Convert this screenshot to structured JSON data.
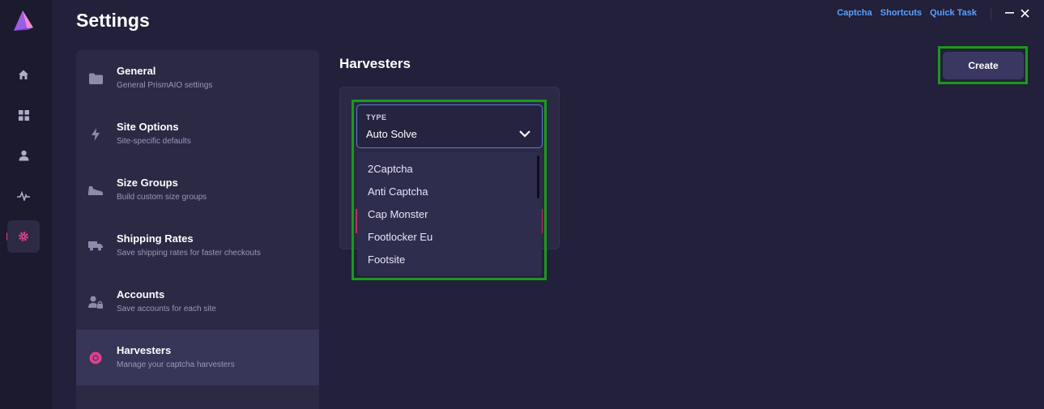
{
  "app": {
    "title": "Settings",
    "brand_color": "#a060e0",
    "accent": "#e0408a"
  },
  "rail": {
    "items": [
      {
        "name": "home",
        "icon": "home-icon"
      },
      {
        "name": "dashboard",
        "icon": "grid-icon"
      },
      {
        "name": "profiles",
        "icon": "user-icon"
      },
      {
        "name": "activity",
        "icon": "activity-icon"
      },
      {
        "name": "settings",
        "icon": "gear-icon",
        "active": true
      }
    ]
  },
  "top_links": {
    "captcha": "Captcha",
    "shortcuts": "Shortcuts",
    "quick_task": "Quick Task"
  },
  "menu": {
    "items": [
      {
        "title": "General",
        "desc": "General PrismAIO settings",
        "icon": "folder-icon"
      },
      {
        "title": "Site Options",
        "desc": "Site-specific defaults",
        "icon": "bolt-icon"
      },
      {
        "title": "Size Groups",
        "desc": "Build custom size groups",
        "icon": "shoe-icon"
      },
      {
        "title": "Shipping Rates",
        "desc": "Save shipping rates for faster checkouts",
        "icon": "truck-icon"
      },
      {
        "title": "Accounts",
        "desc": "Save accounts for each site",
        "icon": "user-lock-icon"
      },
      {
        "title": "Harvesters",
        "desc": "Manage your captcha harvesters",
        "icon": "chrome-icon",
        "active": true
      }
    ]
  },
  "harvesters": {
    "title": "Harvesters",
    "create_label": "Create",
    "type_label": "TYPE",
    "type_value": "Auto Solve",
    "options": [
      "2Captcha",
      "Anti Captcha",
      "Cap Monster",
      "Footlocker Eu",
      "Footsite"
    ]
  }
}
